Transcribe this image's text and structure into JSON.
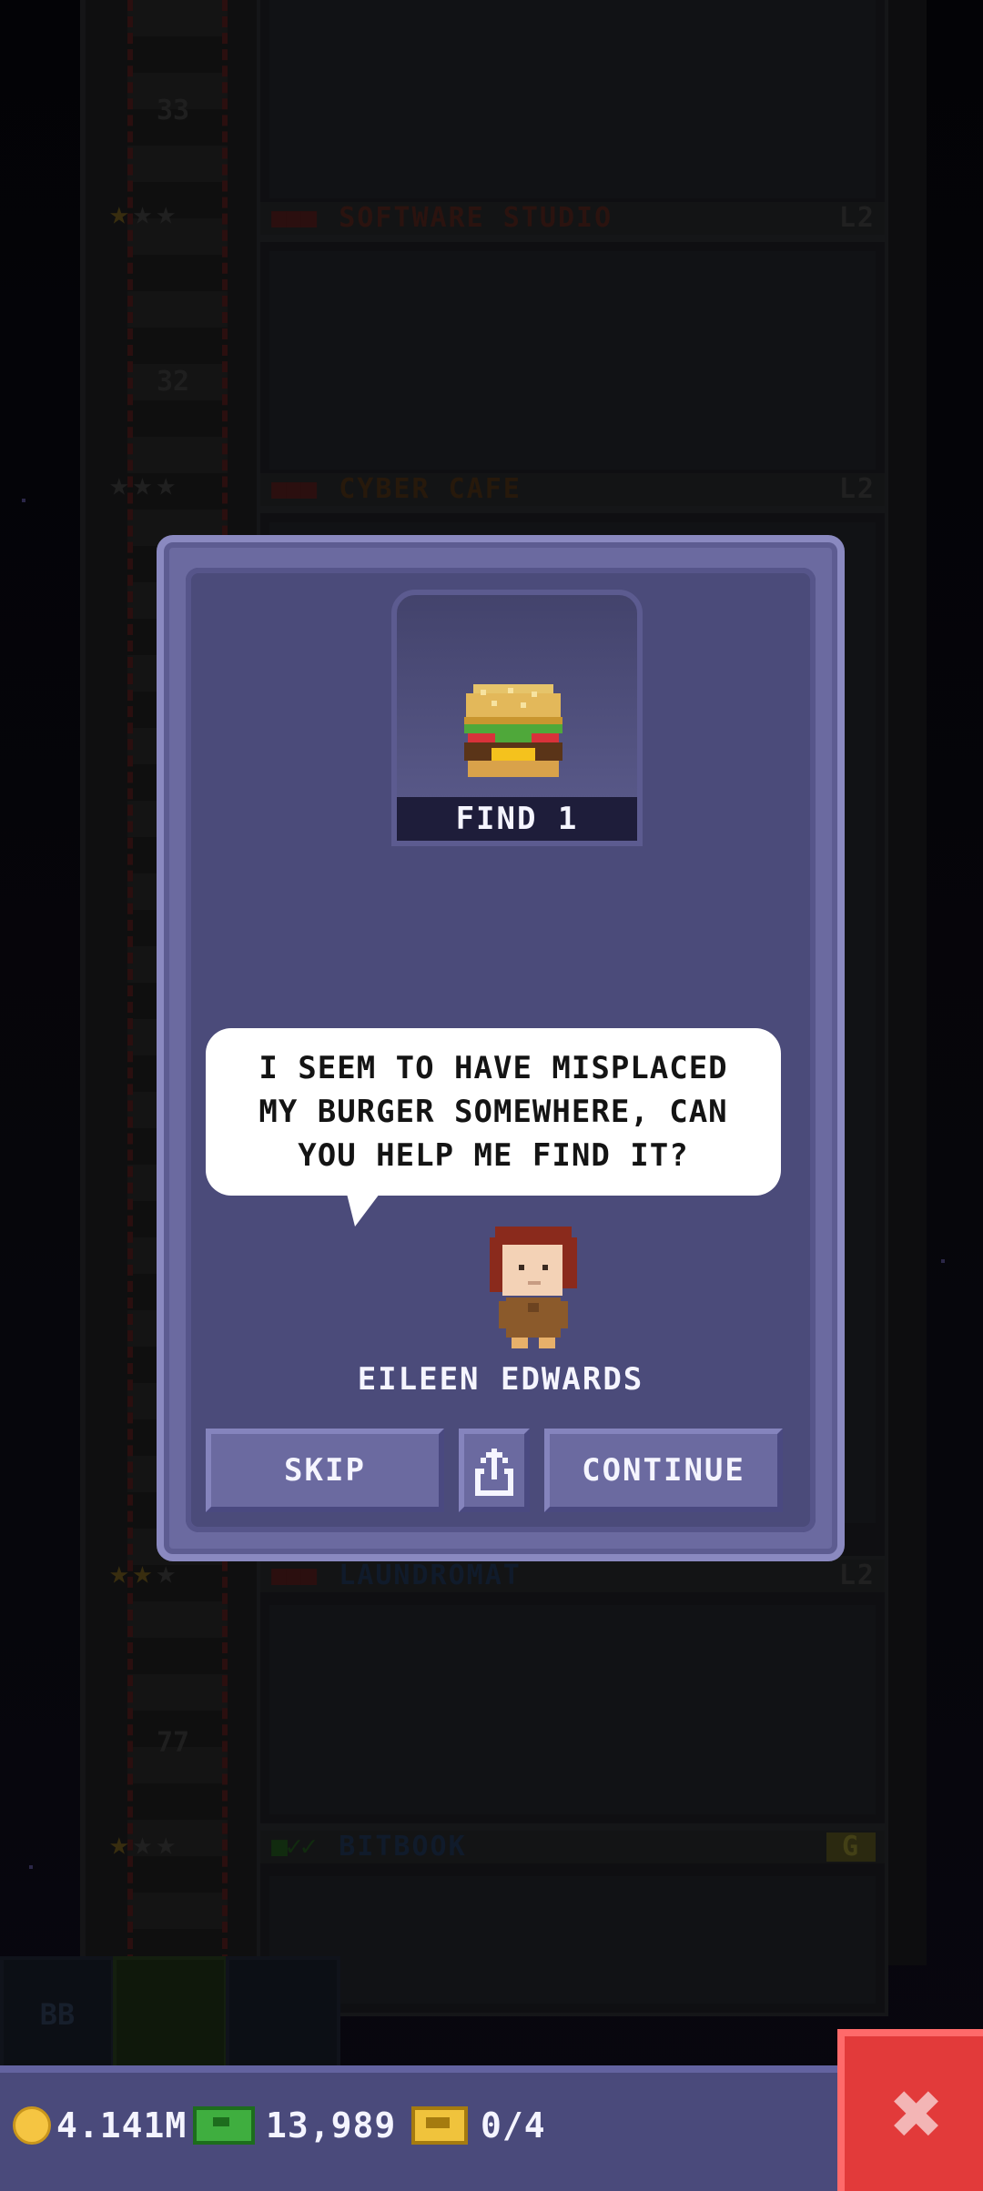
{
  "tower": {
    "elevator_numbers": [
      "33",
      "32",
      "77"
    ],
    "floors": [
      {
        "name": "SOFTWARE STUDIO",
        "stock": "■■■",
        "level": "L2"
      },
      {
        "name": "CYBER CAFE",
        "stock": "■■■",
        "level": "L2"
      },
      {
        "name": "LAUNDROMAT",
        "stock": "■■■",
        "level": "L2"
      },
      {
        "name": "BITBOOK",
        "stock": "■✓✓",
        "level": "G"
      }
    ],
    "bottom_tabs": [
      "BB",
      "",
      ""
    ]
  },
  "dialog": {
    "item": {
      "icon": "burger-icon",
      "label": "FIND 1"
    },
    "speech": "I SEEM TO HAVE MISPLACED MY BURGER SOMEWHERE, CAN YOU HELP ME FIND IT?",
    "character_name": "EILEEN EDWARDS",
    "buttons": {
      "skip": "SKIP",
      "share_icon": "share-icon",
      "continue": "CONTINUE"
    }
  },
  "status_bar": {
    "coins": "4.141M",
    "bux": "13,989",
    "tickets": "0/4"
  },
  "close_icon": "close-icon",
  "colors": {
    "dialog_bg": "#4b4b7a",
    "dialog_border": "#8a89c0",
    "status_bar": "#4a4a7b",
    "close_button": "#e23a3a"
  }
}
